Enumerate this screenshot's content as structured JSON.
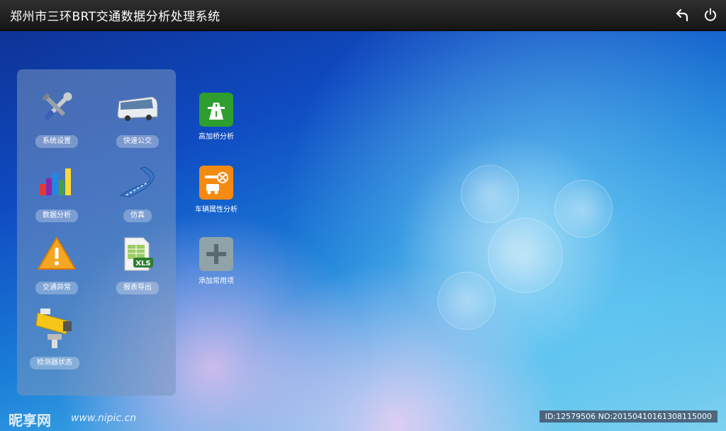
{
  "header": {
    "title": "郑州市三环BRT交通数据分析处理系统"
  },
  "toolbar": {
    "back_icon": "undo-arrow-icon",
    "power_icon": "power-icon"
  },
  "panel_tiles": [
    {
      "label": "系统设置",
      "icon": "tools-icon"
    },
    {
      "label": "快速公交",
      "icon": "bus-icon"
    },
    {
      "label": "数据分析",
      "icon": "bar-chart-icon"
    },
    {
      "label": "仿真",
      "icon": "road-icon"
    },
    {
      "label": "交通异常",
      "icon": "warning-icon"
    },
    {
      "label": "报表导出",
      "icon": "xls-icon"
    },
    {
      "label": "检测器状态",
      "icon": "camera-icon"
    }
  ],
  "quick_tiles": [
    {
      "label": "高加桥分析",
      "icon": "highway-icon",
      "color": "#2e9e2e"
    },
    {
      "label": "车辆属性分析",
      "icon": "vehicle-tools-icon",
      "color": "#f58a10"
    },
    {
      "label": "添加常用项",
      "icon": "plus-icon",
      "color": "#8fa3a8"
    }
  ],
  "watermark": {
    "logo": "昵享网",
    "url": "www.nipic.cn"
  },
  "footer": {
    "id_text": "ID:12579506 NO:20150410161308115000"
  }
}
